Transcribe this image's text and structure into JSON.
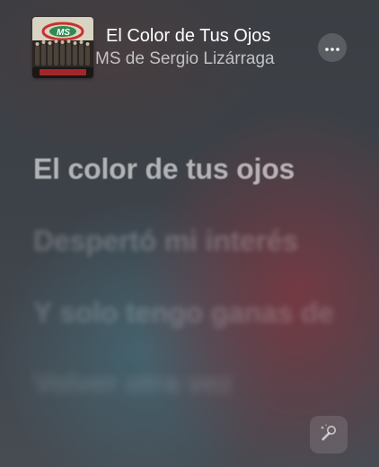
{
  "now_playing": {
    "title": "El Color de Tus Ojos",
    "artist": "MS de Sergio Lizárraga",
    "artwork_icon": "album-artwork",
    "more_icon": "ellipsis-icon"
  },
  "lyrics": {
    "lines": [
      "El color de tus ojos",
      "Despertó mi interés",
      "Y solo tengo ganas de",
      "Volver otra vez"
    ],
    "current_index": 0
  },
  "controls": {
    "sing_icon": "microphone-sparkle-icon"
  },
  "colors": {
    "background_red": "#7d3741",
    "background_teal": "#467887",
    "background_base": "#3d4249"
  }
}
